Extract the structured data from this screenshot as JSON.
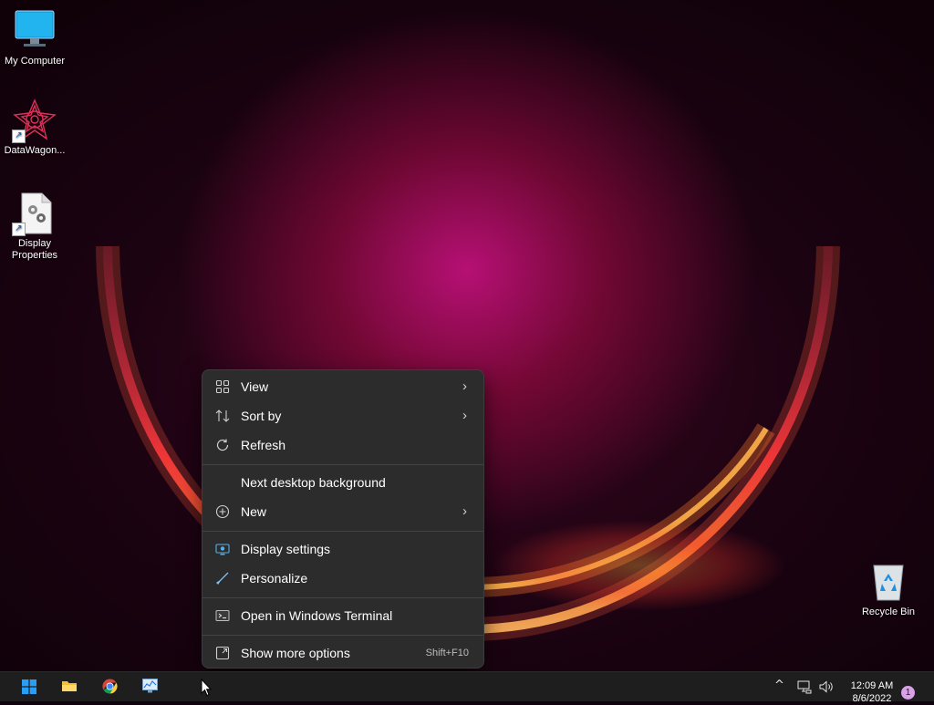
{
  "desktop": {
    "icons": [
      {
        "label": "My Computer",
        "icon": "monitor-icon"
      },
      {
        "label": "DataWagon...",
        "icon": "datawagon-logo-icon"
      },
      {
        "label": "Display Properties",
        "icon": "display-properties-icon"
      },
      {
        "label": "Recycle Bin",
        "icon": "recycle-bin-icon"
      }
    ]
  },
  "context_menu": {
    "items": [
      {
        "label": "View",
        "icon": "grid-view-icon",
        "submenu": true
      },
      {
        "label": "Sort by",
        "icon": "sort-icon",
        "submenu": true
      },
      {
        "label": "Refresh",
        "icon": "refresh-icon"
      },
      {
        "label": "Next desktop background"
      },
      {
        "label": "New",
        "icon": "plus-circle-icon",
        "submenu": true
      },
      {
        "label": "Display settings",
        "icon": "display-settings-icon"
      },
      {
        "label": "Personalize",
        "icon": "brush-icon"
      },
      {
        "label": "Open in Windows Terminal",
        "icon": "terminal-icon"
      },
      {
        "label": "Show more options",
        "icon": "more-options-icon",
        "shortcut": "Shift+F10"
      }
    ],
    "arrow_glyph": "›"
  },
  "taskbar": {
    "apps": [
      {
        "name": "start",
        "icon": "windows-start-icon"
      },
      {
        "name": "file-explorer",
        "icon": "folder-icon"
      },
      {
        "name": "chrome",
        "icon": "chrome-icon"
      },
      {
        "name": "task-manager",
        "icon": "task-manager-icon"
      }
    ],
    "tray": {
      "chevron": "^",
      "time": "12:09 AM",
      "date": "8/6/2022",
      "notification_count": "1"
    }
  },
  "colors": {
    "menu_bg": "#2c2c2c",
    "taskbar_bg": "#1e1e1e",
    "accent": "#0078d4"
  }
}
